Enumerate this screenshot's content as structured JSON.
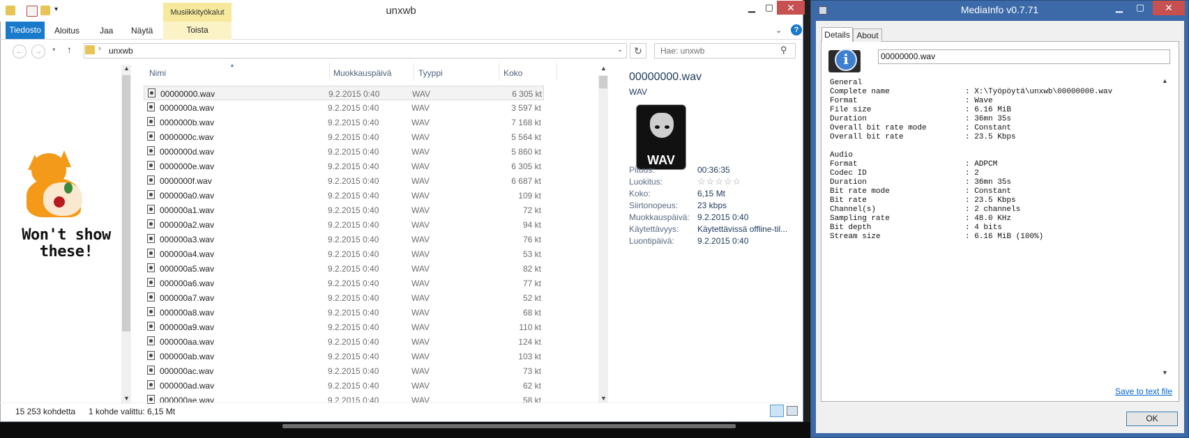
{
  "explorer": {
    "title": "unxwb",
    "context_tab_group": "Musiikkityökalut",
    "tabs": [
      "Tiedosto",
      "Aloitus",
      "Jaa",
      "Näytä",
      "Toista"
    ],
    "address": {
      "path": "unxwb"
    },
    "search": {
      "placeholder": "Hae: unxwb"
    },
    "nav_pane": {
      "caption_line1": "Won't show",
      "caption_line2": "these!"
    },
    "columns": [
      "Nimi",
      "Muokkauspäivä",
      "Tyyppi",
      "Koko"
    ],
    "files": [
      {
        "name": "00000000.wav",
        "date": "9.2.2015 0:40",
        "type": "WAV",
        "size": "6 305 kt"
      },
      {
        "name": "0000000a.wav",
        "date": "9.2.2015 0:40",
        "type": "WAV",
        "size": "3 597 kt"
      },
      {
        "name": "0000000b.wav",
        "date": "9.2.2015 0:40",
        "type": "WAV",
        "size": "7 168 kt"
      },
      {
        "name": "0000000c.wav",
        "date": "9.2.2015 0:40",
        "type": "WAV",
        "size": "5 564 kt"
      },
      {
        "name": "0000000d.wav",
        "date": "9.2.2015 0:40",
        "type": "WAV",
        "size": "5 860 kt"
      },
      {
        "name": "0000000e.wav",
        "date": "9.2.2015 0:40",
        "type": "WAV",
        "size": "6 305 kt"
      },
      {
        "name": "0000000f.wav",
        "date": "9.2.2015 0:40",
        "type": "WAV",
        "size": "6 687 kt"
      },
      {
        "name": "000000a0.wav",
        "date": "9.2.2015 0:40",
        "type": "WAV",
        "size": "109 kt"
      },
      {
        "name": "000000a1.wav",
        "date": "9.2.2015 0:40",
        "type": "WAV",
        "size": "72 kt"
      },
      {
        "name": "000000a2.wav",
        "date": "9.2.2015 0:40",
        "type": "WAV",
        "size": "94 kt"
      },
      {
        "name": "000000a3.wav",
        "date": "9.2.2015 0:40",
        "type": "WAV",
        "size": "76 kt"
      },
      {
        "name": "000000a4.wav",
        "date": "9.2.2015 0:40",
        "type": "WAV",
        "size": "53 kt"
      },
      {
        "name": "000000a5.wav",
        "date": "9.2.2015 0:40",
        "type": "WAV",
        "size": "82 kt"
      },
      {
        "name": "000000a6.wav",
        "date": "9.2.2015 0:40",
        "type": "WAV",
        "size": "77 kt"
      },
      {
        "name": "000000a7.wav",
        "date": "9.2.2015 0:40",
        "type": "WAV",
        "size": "52 kt"
      },
      {
        "name": "000000a8.wav",
        "date": "9.2.2015 0:40",
        "type": "WAV",
        "size": "68 kt"
      },
      {
        "name": "000000a9.wav",
        "date": "9.2.2015 0:40",
        "type": "WAV",
        "size": "110 kt"
      },
      {
        "name": "000000aa.wav",
        "date": "9.2.2015 0:40",
        "type": "WAV",
        "size": "124 kt"
      },
      {
        "name": "000000ab.wav",
        "date": "9.2.2015 0:40",
        "type": "WAV",
        "size": "103 kt"
      },
      {
        "name": "000000ac.wav",
        "date": "9.2.2015 0:40",
        "type": "WAV",
        "size": "73 kt"
      },
      {
        "name": "000000ad.wav",
        "date": "9.2.2015 0:40",
        "type": "WAV",
        "size": "62 kt"
      },
      {
        "name": "000000ae.wav",
        "date": "9.2.2015 0:40",
        "type": "WAV",
        "size": "58 kt"
      }
    ],
    "details": {
      "title": "00000000.wav",
      "type": "WAV",
      "icon_label": "WAV",
      "props": [
        {
          "label": "Pituus:",
          "value": "00:36:35"
        },
        {
          "label": "Luokitus:",
          "value": ""
        },
        {
          "label": "Koko:",
          "value": "6,15 Mt"
        },
        {
          "label": "Siirtonopeus:",
          "value": "23 kbps"
        },
        {
          "label": "Muokkauspäivä:",
          "value": "9.2.2015 0:40"
        },
        {
          "label": "Käytettävyys:",
          "value": "Käytettävissä offline-til..."
        },
        {
          "label": "Luontipäivä:",
          "value": "9.2.2015 0:40"
        }
      ],
      "rating_stars": 0
    },
    "status": {
      "count": "15 253 kohdetta",
      "selected": "1 kohde valittu: 6,15 Mt"
    }
  },
  "mediainfo": {
    "title": "MediaInfo v0.7.71",
    "tabs": [
      "Details",
      "About"
    ],
    "file": "00000000.wav",
    "lines": [
      {
        "k": "General",
        "v": ""
      },
      {
        "k": "Complete name",
        "v": ": X:\\Työpöytä\\unxwb\\00000000.wav"
      },
      {
        "k": "Format",
        "v": ": Wave"
      },
      {
        "k": "File size",
        "v": ": 6.16 MiB"
      },
      {
        "k": "Duration",
        "v": ": 36mn 35s"
      },
      {
        "k": "Overall bit rate mode",
        "v": ": Constant"
      },
      {
        "k": "Overall bit rate",
        "v": ": 23.5 Kbps"
      },
      {
        "k": "",
        "v": ""
      },
      {
        "k": "Audio",
        "v": ""
      },
      {
        "k": "Format",
        "v": ": ADPCM"
      },
      {
        "k": "Codec ID",
        "v": ": 2"
      },
      {
        "k": "Duration",
        "v": ": 36mn 35s"
      },
      {
        "k": "Bit rate mode",
        "v": ": Constant"
      },
      {
        "k": "Bit rate",
        "v": ": 23.5 Kbps"
      },
      {
        "k": "Channel(s)",
        "v": ": 2 channels"
      },
      {
        "k": "Sampling rate",
        "v": ": 48.0 KHz"
      },
      {
        "k": "Bit depth",
        "v": ": 4 bits"
      },
      {
        "k": "Stream size",
        "v": ": 6.16 MiB (100%)"
      }
    ],
    "save_link": "Save to text file",
    "ok_label": "OK"
  },
  "colors": {
    "accent": "#1979ca",
    "context_tab": "#f6e99b",
    "mediainfo_frame": "#3c6aa8",
    "close_red": "#c75050"
  }
}
